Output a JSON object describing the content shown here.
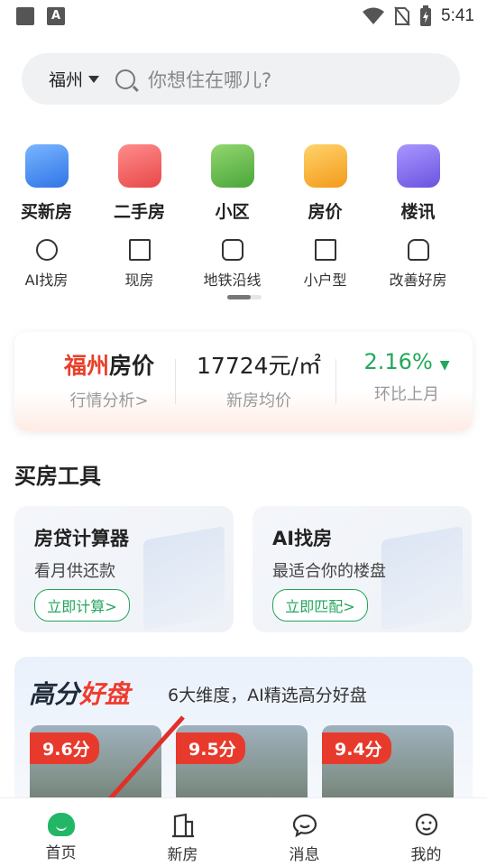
{
  "status": {
    "time": "5:41"
  },
  "search": {
    "city": "福州",
    "placeholder": "你想住在哪儿?"
  },
  "categories": [
    {
      "label": "买新房",
      "color": "#3a86f0",
      "icon": "building-icon"
    },
    {
      "label": "二手房",
      "color": "#f05a5a",
      "icon": "house-icon"
    },
    {
      "label": "小区",
      "color": "#5fb84a",
      "icon": "community-icon"
    },
    {
      "label": "房价",
      "color": "#f5a623",
      "icon": "price-tag-icon"
    },
    {
      "label": "楼讯",
      "color": "#7a63e8",
      "icon": "news-icon"
    }
  ],
  "quick_links": [
    {
      "label": "AI找房",
      "icon": "ai-icon"
    },
    {
      "label": "现房",
      "icon": "building-outline-icon"
    },
    {
      "label": "地铁沿线",
      "icon": "metro-icon"
    },
    {
      "label": "小户型",
      "icon": "floorplan-icon"
    },
    {
      "label": "改善好房",
      "icon": "home-outline-icon"
    }
  ],
  "price_card": {
    "city": "福州",
    "title_suffix": "房价",
    "analysis": "行情分析>",
    "avg_price": "17724元/㎡",
    "avg_label": "新房均价",
    "change": "2.16%",
    "change_label": "环比上月"
  },
  "tools_section": {
    "title": "买房工具",
    "tools": [
      {
        "title": "房贷计算器",
        "sub": "看月供还款",
        "button": "立即计算>"
      },
      {
        "title": "AI找房",
        "sub": "最适合你的楼盘",
        "button": "立即匹配>"
      }
    ]
  },
  "hot": {
    "logo_a": "高分",
    "logo_b": "好盘",
    "desc": "6大维度，AI精选高分好盘",
    "listings": [
      {
        "score": "9.6分"
      },
      {
        "score": "9.5分"
      },
      {
        "score": "9.4分"
      }
    ]
  },
  "tabs": [
    {
      "label": "首页",
      "icon": "home-icon"
    },
    {
      "label": "新房",
      "icon": "building-icon"
    },
    {
      "label": "消息",
      "icon": "message-icon"
    },
    {
      "label": "我的",
      "icon": "profile-icon"
    }
  ],
  "colors": {
    "accent": "#23a55c",
    "red": "#e8402a"
  }
}
